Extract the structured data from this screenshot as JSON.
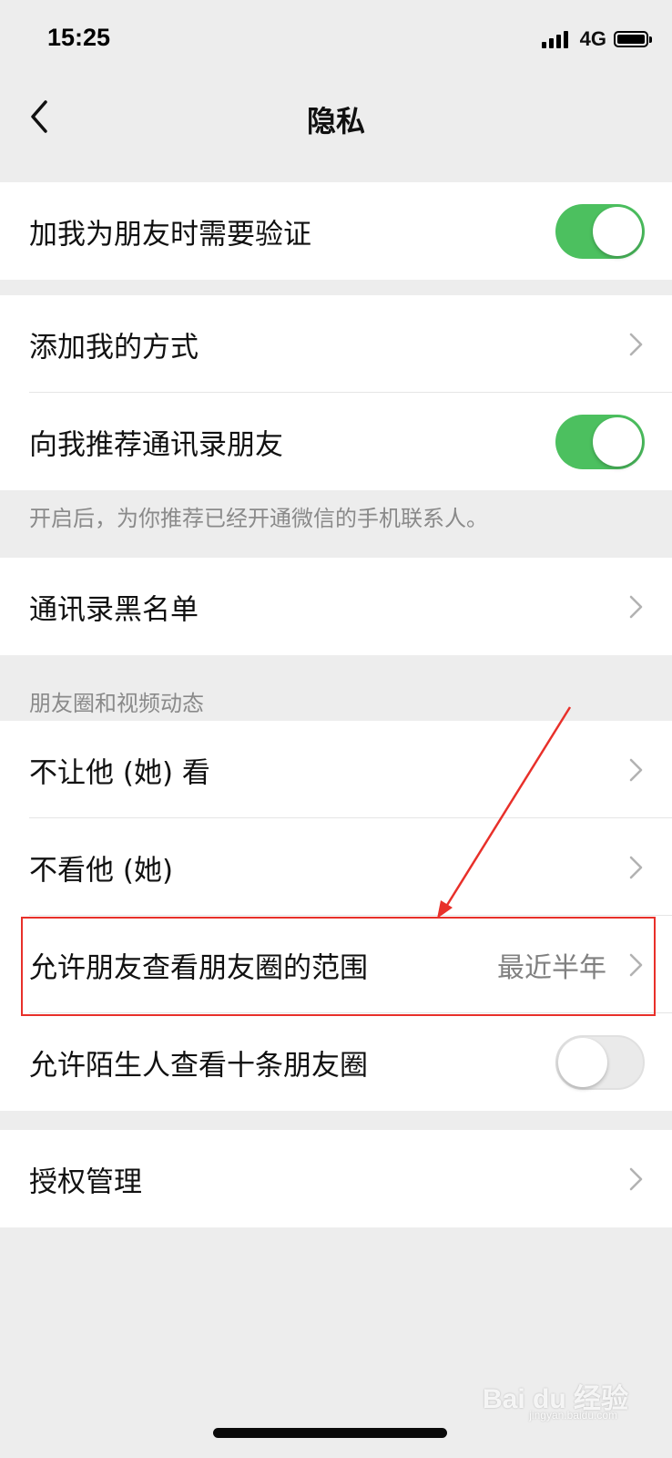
{
  "status_bar": {
    "time": "15:25",
    "network": "4G",
    "signal_icon": "signal-bars-icon",
    "battery_icon": "battery-icon"
  },
  "nav": {
    "title": "隐私",
    "back_icon": "chevron-left-icon"
  },
  "groups": [
    {
      "cells": [
        {
          "label": "加我为朋友时需要验证",
          "toggle": true
        }
      ]
    },
    {
      "cells": [
        {
          "label": "添加我的方式",
          "chevron": true
        },
        {
          "label": "向我推荐通讯录朋友",
          "toggle": true
        }
      ],
      "note": "开启后，为你推荐已经开通微信的手机联系人。"
    },
    {
      "cells": [
        {
          "label": "通讯录黑名单",
          "chevron": true
        }
      ]
    },
    {
      "header": "朋友圈和视频动态",
      "cells": [
        {
          "label": "不让他 (她) 看",
          "chevron": true
        },
        {
          "label": "不看他 (她)",
          "chevron": true
        },
        {
          "label": "允许朋友查看朋友圈的范围",
          "value": "最近半年",
          "chevron": true,
          "highlighted": true
        },
        {
          "label": "允许陌生人查看十条朋友圈",
          "toggle": false
        }
      ]
    },
    {
      "cells": [
        {
          "label": "授权管理",
          "chevron": true
        }
      ]
    }
  ],
  "colors": {
    "background": "#EDEDED",
    "toggle_on": "#4CC05F",
    "highlight": "#E8302A",
    "secondary_text": "#808080"
  },
  "watermark": {
    "text": "Bai du 经验",
    "sub": "jingyan.baidu.com"
  }
}
